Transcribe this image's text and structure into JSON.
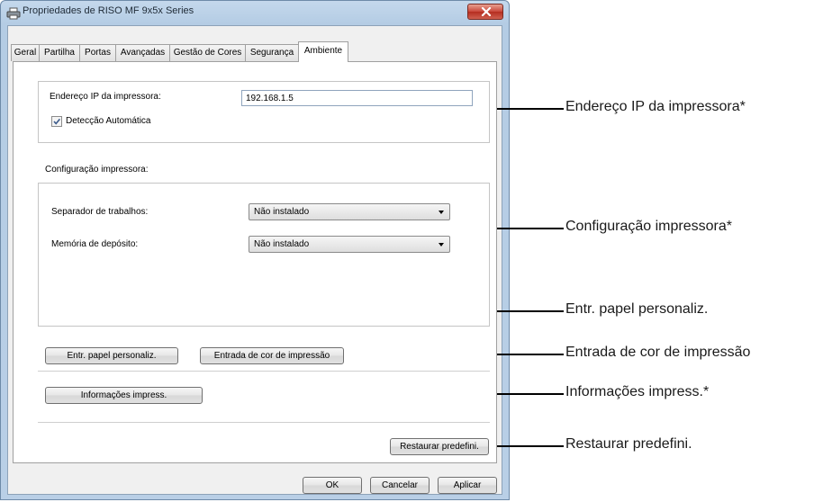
{
  "window": {
    "title": "Propriedades de RISO MF 9x5x Series",
    "ok_label": "OK",
    "cancel_label": "Cancelar",
    "apply_label": "Aplicar"
  },
  "tabs": [
    {
      "label": "Geral"
    },
    {
      "label": "Partilha"
    },
    {
      "label": "Portas"
    },
    {
      "label": "Avançadas"
    },
    {
      "label": "Gestão de Cores"
    },
    {
      "label": "Segurança"
    },
    {
      "label": "Ambiente",
      "active": true
    }
  ],
  "ambiente": {
    "ip_label": "Endereço IP da impressora:",
    "ip_value": "192.168.1.5",
    "auto_detect_label": "Detecção Automática",
    "auto_detect_checked": true,
    "config_heading": "Configuração impressora:",
    "job_separator_label": "Separador de trabalhos:",
    "job_separator_value": "Não instalado",
    "storage_memory_label": "Memória de depósito:",
    "storage_memory_value": "Não instalado",
    "custom_paper_button": "Entr. papel personaliz.",
    "color_entry_button": "Entrada de cor de impressão",
    "printer_info_button": "Informações impress.",
    "restore_defaults_button": "Restaurar predefini."
  },
  "annotations": {
    "ip_address": "Endereço IP da impressora*",
    "printer_config": "Configuração impressora*",
    "custom_paper": "Entr. papel personaliz.",
    "color_entry": "Entrada de cor de impressão",
    "printer_info": "Informações impress.*",
    "restore_defaults": "Restaurar predefini."
  }
}
